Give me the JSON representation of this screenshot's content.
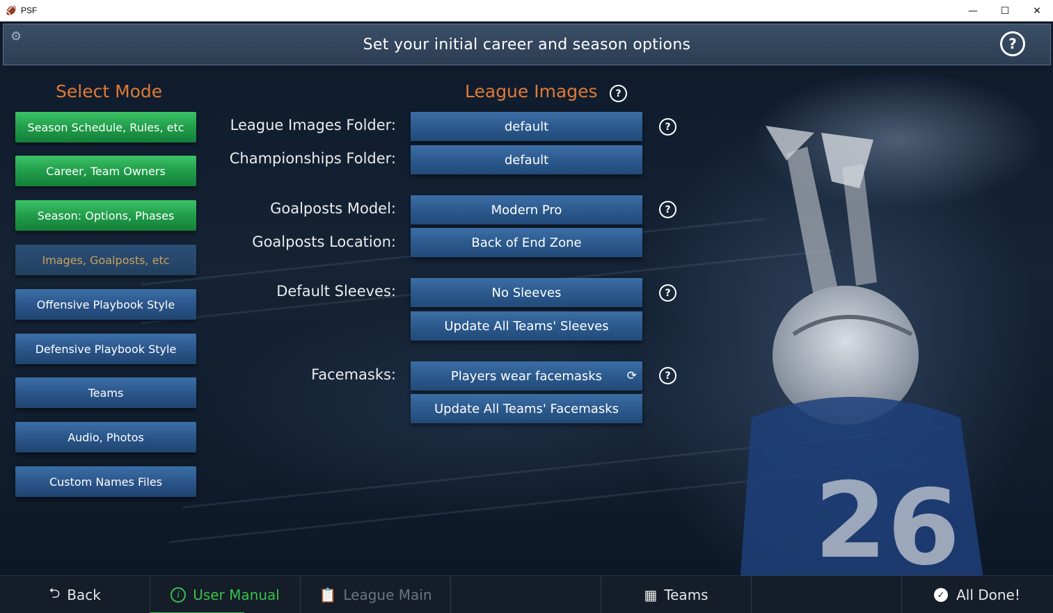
{
  "window": {
    "title": "PSF",
    "minimize": "—",
    "maximize": "☐",
    "close": "✕"
  },
  "header": {
    "title": "Set your initial career and season options",
    "help": "?"
  },
  "left": {
    "title": "Select Mode",
    "items": [
      {
        "label": "Season Schedule, Rules, etc",
        "style": "green"
      },
      {
        "label": "Career, Team Owners",
        "style": "green"
      },
      {
        "label": "Season: Options, Phases",
        "style": "green"
      },
      {
        "label": "Images, Goalposts, etc",
        "style": "active"
      },
      {
        "label": "Offensive Playbook Style",
        "style": "blue"
      },
      {
        "label": "Defensive Playbook Style",
        "style": "blue"
      },
      {
        "label": "Teams",
        "style": "blue"
      },
      {
        "label": "Audio, Photos",
        "style": "blue"
      },
      {
        "label": "Custom Names Files",
        "style": "blue"
      }
    ]
  },
  "main": {
    "title": "League Images",
    "help": "?",
    "league_images_folder": {
      "label": "League Images Folder:",
      "value": "default"
    },
    "championships_folder": {
      "label": "Championships Folder:",
      "value": "default"
    },
    "goalposts_model": {
      "label": "Goalposts Model:",
      "value": "Modern Pro"
    },
    "goalposts_location": {
      "label": "Goalposts Location:",
      "value": "Back of End Zone"
    },
    "default_sleeves": {
      "label": "Default Sleeves:",
      "value": "No Sleeves"
    },
    "update_sleeves": "Update All Teams' Sleeves",
    "facemasks": {
      "label": "Facemasks:",
      "value": "Players wear facemasks"
    },
    "update_facemasks": "Update All Teams' Facemasks"
  },
  "bottom": {
    "back": "Back",
    "user_manual": "User Manual",
    "league_main": "League Main",
    "teams": "Teams",
    "all_done": "All Done!"
  },
  "colors": {
    "accent_orange": "#e07a35",
    "green": "#1f9a48",
    "blue": "#2a5488",
    "manual_green": "#37c24d"
  }
}
